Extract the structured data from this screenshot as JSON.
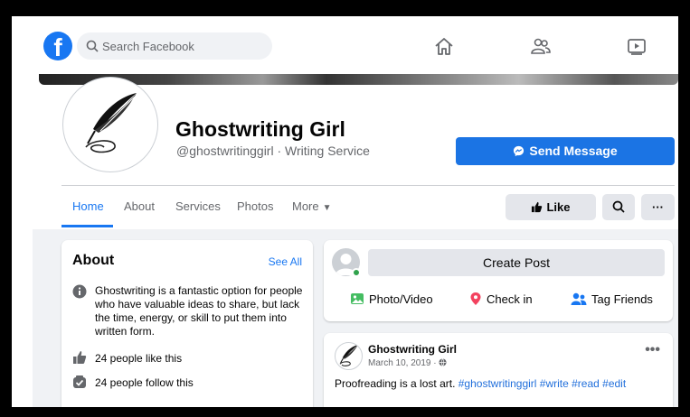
{
  "nav": {
    "logo_letter": "f",
    "search_placeholder": "Search Facebook",
    "icons": [
      "home-icon",
      "people-icon",
      "watch-icon"
    ]
  },
  "profile": {
    "name": "Ghostwriting Girl",
    "handle_line": "@ghostwritinggirl · Writing Service",
    "send_message_label": "Send Message"
  },
  "tabs": [
    {
      "label": "Home",
      "active": true
    },
    {
      "label": "About"
    },
    {
      "label": "Services"
    },
    {
      "label": "Photos"
    },
    {
      "label": "More"
    }
  ],
  "actions": {
    "like_label": "Like",
    "more_label": "···"
  },
  "about": {
    "title": "About",
    "see_all": "See All",
    "description": "Ghostwriting is a fantastic option for people who have valuable ideas to share, but lack the time, energy, or skill to put them into written form.",
    "likes": "24 people like this",
    "follows": "24 people follow this"
  },
  "create_post": {
    "button": "Create Post",
    "photo_video": "Photo/Video",
    "check_in": "Check in",
    "tag_friends": "Tag Friends"
  },
  "post": {
    "author": "Ghostwriting Girl",
    "date": "March 10, 2019 ·",
    "text": "Proofreading is a lost art.",
    "hashtags": "#ghostwritinggirl #write #read #edit",
    "menu": "•••"
  },
  "colors": {
    "brand_blue": "#1877f2",
    "button_blue": "#1b74e4",
    "background": "#f0f2f5",
    "secondary_button": "#e4e6eb"
  }
}
